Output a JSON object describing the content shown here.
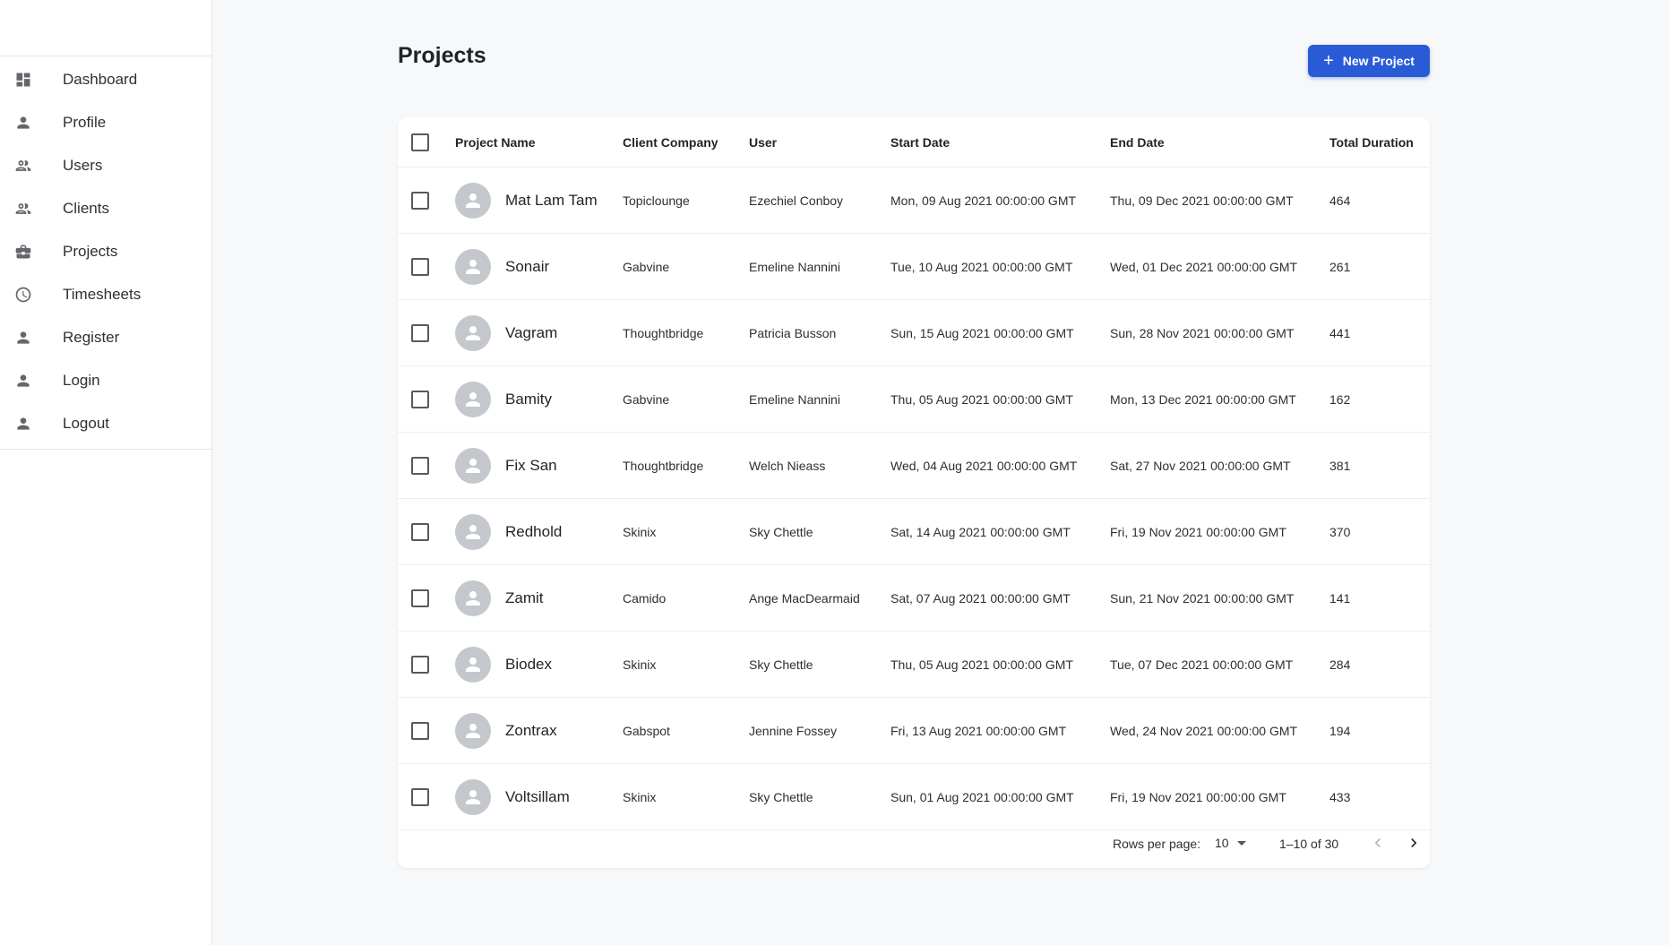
{
  "sidebar": {
    "items": [
      {
        "label": "Dashboard",
        "icon": "dashboard-icon"
      },
      {
        "label": "Profile",
        "icon": "person-icon"
      },
      {
        "label": "Users",
        "icon": "group-icon"
      },
      {
        "label": "Clients",
        "icon": "group-icon"
      },
      {
        "label": "Projects",
        "icon": "briefcase-icon"
      },
      {
        "label": "Timesheets",
        "icon": "clock-icon"
      },
      {
        "label": "Register",
        "icon": "person-icon"
      },
      {
        "label": "Login",
        "icon": "person-icon"
      },
      {
        "label": "Logout",
        "icon": "person-icon"
      }
    ]
  },
  "header": {
    "title": "Projects",
    "new_button_label": "New Project"
  },
  "table": {
    "columns": [
      "Project Name",
      "Client Company",
      "User",
      "Start Date",
      "End Date",
      "Total Duration"
    ],
    "rows": [
      {
        "name": "Mat Lam Tam",
        "client": "Topiclounge",
        "user": "Ezechiel Conboy",
        "start": "Mon, 09 Aug 2021 00:00:00 GMT",
        "end": "Thu, 09 Dec 2021 00:00:00 GMT",
        "duration": "464"
      },
      {
        "name": "Sonair",
        "client": "Gabvine",
        "user": "Emeline Nannini",
        "start": "Tue, 10 Aug 2021 00:00:00 GMT",
        "end": "Wed, 01 Dec 2021 00:00:00 GMT",
        "duration": "261"
      },
      {
        "name": "Vagram",
        "client": "Thoughtbridge",
        "user": "Patricia Busson",
        "start": "Sun, 15 Aug 2021 00:00:00 GMT",
        "end": "Sun, 28 Nov 2021 00:00:00 GMT",
        "duration": "441"
      },
      {
        "name": "Bamity",
        "client": "Gabvine",
        "user": "Emeline Nannini",
        "start": "Thu, 05 Aug 2021 00:00:00 GMT",
        "end": "Mon, 13 Dec 2021 00:00:00 GMT",
        "duration": "162"
      },
      {
        "name": "Fix San",
        "client": "Thoughtbridge",
        "user": "Welch Nieass",
        "start": "Wed, 04 Aug 2021 00:00:00 GMT",
        "end": "Sat, 27 Nov 2021 00:00:00 GMT",
        "duration": "381"
      },
      {
        "name": "Redhold",
        "client": "Skinix",
        "user": "Sky Chettle",
        "start": "Sat, 14 Aug 2021 00:00:00 GMT",
        "end": "Fri, 19 Nov 2021 00:00:00 GMT",
        "duration": "370"
      },
      {
        "name": "Zamit",
        "client": "Camido",
        "user": "Ange MacDearmaid",
        "start": "Sat, 07 Aug 2021 00:00:00 GMT",
        "end": "Sun, 21 Nov 2021 00:00:00 GMT",
        "duration": "141"
      },
      {
        "name": "Biodex",
        "client": "Skinix",
        "user": "Sky Chettle",
        "start": "Thu, 05 Aug 2021 00:00:00 GMT",
        "end": "Tue, 07 Dec 2021 00:00:00 GMT",
        "duration": "284"
      },
      {
        "name": "Zontrax",
        "client": "Gabspot",
        "user": "Jennine Fossey",
        "start": "Fri, 13 Aug 2021 00:00:00 GMT",
        "end": "Wed, 24 Nov 2021 00:00:00 GMT",
        "duration": "194"
      },
      {
        "name": "Voltsillam",
        "client": "Skinix",
        "user": "Sky Chettle",
        "start": "Sun, 01 Aug 2021 00:00:00 GMT",
        "end": "Fri, 19 Nov 2021 00:00:00 GMT",
        "duration": "433"
      }
    ]
  },
  "pagination": {
    "rows_per_page_label": "Rows per page:",
    "rows_per_page_value": "10",
    "range_label": "1–10 of 30"
  },
  "colors": {
    "accent": "#2a5bd7",
    "background": "#f7f8fa",
    "avatar": "#c4c8cd"
  }
}
